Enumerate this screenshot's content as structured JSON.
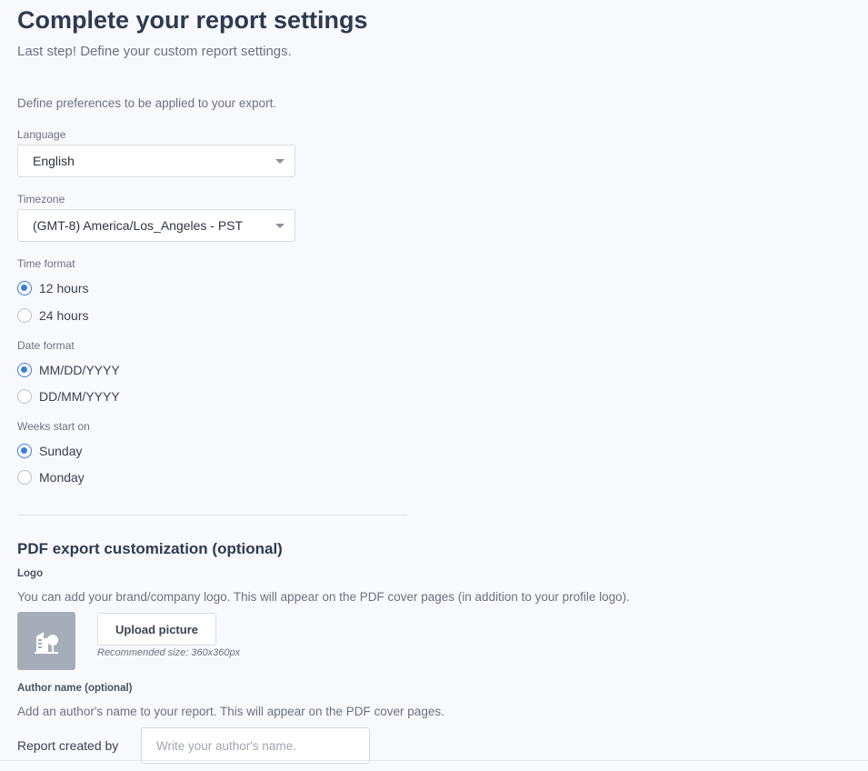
{
  "header": {
    "title": "Complete your report settings",
    "subtitle": "Last step! Define your custom report settings."
  },
  "preferences": {
    "intro": "Define preferences to be applied to your export.",
    "language": {
      "label": "Language",
      "value": "English"
    },
    "timezone": {
      "label": "Timezone",
      "value": "(GMT-8) America/Los_Angeles - PST"
    },
    "time_format": {
      "label": "Time format",
      "options": [
        "12 hours",
        "24 hours"
      ],
      "selected": "12 hours"
    },
    "date_format": {
      "label": "Date format",
      "options": [
        "MM/DD/YYYY",
        "DD/MM/YYYY"
      ],
      "selected": "MM/DD/YYYY"
    },
    "week_start": {
      "label": "Weeks start on",
      "options": [
        "Sunday",
        "Monday"
      ],
      "selected": "Sunday"
    }
  },
  "pdf": {
    "section_title": "PDF export customization (optional)",
    "logo": {
      "label": "Logo",
      "help": "You can add your brand/company logo. This will appear on the PDF cover pages (in addition to your profile logo).",
      "upload_label": "Upload picture",
      "recommended": "Recommended size: 360x360px"
    },
    "author": {
      "label": "Author name (optional)",
      "help": "Add an author's name to your report. This will appear on the PDF cover pages.",
      "field_label": "Report created by",
      "placeholder": "Write your author's name.",
      "value": ""
    }
  },
  "icons": {
    "caret": "chevron-down-icon",
    "logo_placeholder": "building-tree-icon"
  },
  "colors": {
    "accent": "#3b7ddd",
    "background": "#f8f9fc",
    "logo_placeholder": "#a7adb8"
  }
}
